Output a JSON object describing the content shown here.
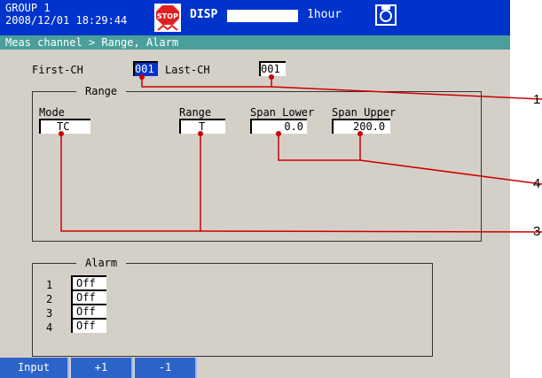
{
  "titlebar": {
    "group": "GROUP 1",
    "datetime": "2008/12/01 18:29:44",
    "disp": "DISP",
    "interval": "1hour",
    "stop_icon": "stop-icon",
    "disk_icon": "disk-icon"
  },
  "breadcrumb": "Meas channel > Range, Alarm",
  "channels": {
    "first_label": "First-CH",
    "first_value": "001",
    "last_label": "Last-CH",
    "last_value": "001"
  },
  "range": {
    "title": "Range",
    "mode_label": "Mode",
    "mode_value": "TC",
    "range_label": "Range",
    "range_value": "T",
    "span_lower_label": "Span Lower",
    "span_lower_value": "0.0",
    "span_upper_label": "Span Upper",
    "span_upper_value": "200.0"
  },
  "alarm": {
    "title": "Alarm",
    "items": [
      {
        "num": "1",
        "value": "Off"
      },
      {
        "num": "2",
        "value": "Off"
      },
      {
        "num": "3",
        "value": "Off"
      },
      {
        "num": "4",
        "value": "Off"
      }
    ]
  },
  "softkeys": [
    "Input",
    "+1",
    "-1"
  ],
  "callouts": [
    "1",
    "4",
    "3"
  ],
  "colors": {
    "titlebar": "#0033cc",
    "breadcrumb": "#4b9f9b",
    "screen": "#d4d0c8",
    "callout_line": "#cc0000"
  }
}
